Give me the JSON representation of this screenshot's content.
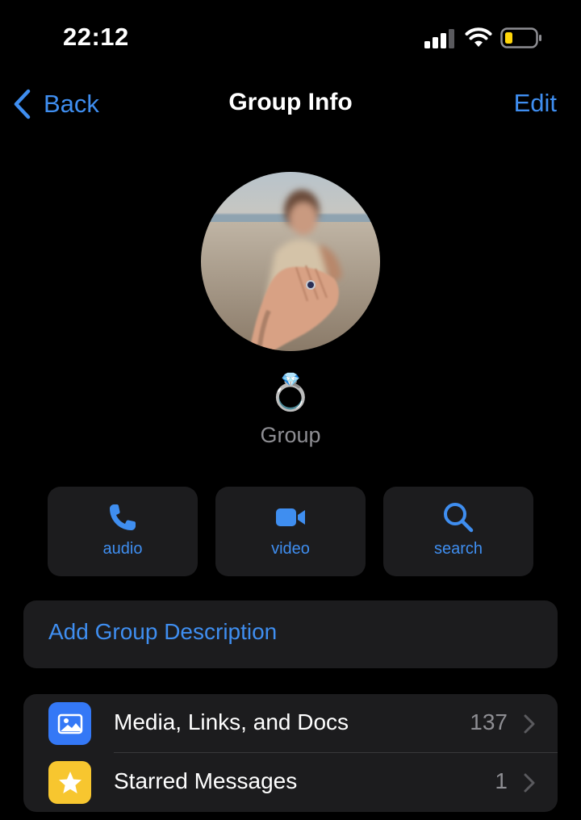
{
  "status_bar": {
    "time": "22:12",
    "icons": [
      "cellular-signal-icon",
      "wifi-icon",
      "battery-low-icon"
    ],
    "battery_color": "#ffd60a"
  },
  "nav": {
    "back_label": "Back",
    "title": "Group Info",
    "edit_label": "Edit"
  },
  "profile": {
    "emoji": "💍",
    "subtitle": "Group"
  },
  "actions": [
    {
      "label": "audio",
      "icon": "phone-icon"
    },
    {
      "label": "video",
      "icon": "video-camera-icon"
    },
    {
      "label": "search",
      "icon": "magnifier-icon"
    }
  ],
  "description": {
    "label": "Add Group Description"
  },
  "list": [
    {
      "label": "Media, Links, and Docs",
      "count": "137",
      "icon": "photo-icon",
      "icon_color": "#3478f6"
    },
    {
      "label": "Starred Messages",
      "count": "1",
      "icon": "star-icon",
      "icon_color": "#f7c62f"
    }
  ],
  "colors": {
    "accent": "#3f8ef0",
    "background": "#000000",
    "card": "#1c1c1e",
    "secondary_text": "#8e8e93"
  }
}
